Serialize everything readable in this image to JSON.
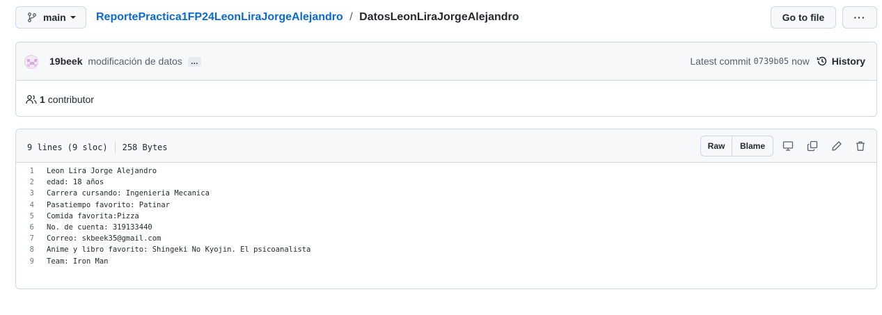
{
  "topbar": {
    "branch": "main",
    "repo": "ReportePractica1FP24LeonLiraJorgeAlejandro",
    "separator": "/",
    "file": "DatosLeonLiraJorgeAlejandro",
    "go_to_file": "Go to file",
    "more": "···"
  },
  "commit": {
    "author": "19beek",
    "message": "modificación de datos",
    "ellipsis": "…",
    "latest_label": "Latest commit",
    "sha": "0739b05",
    "time": "now",
    "history": "History"
  },
  "contributors": {
    "count": "1",
    "label": "contributor"
  },
  "file": {
    "lines_info": "9 lines (9 sloc)",
    "size": "258 Bytes",
    "raw": "Raw",
    "blame": "Blame",
    "lines": [
      {
        "n": "1",
        "text": "Leon Lira Jorge Alejandro"
      },
      {
        "n": "2",
        "text": "edad: 18 años"
      },
      {
        "n": "3",
        "text": "Carrera cursando: Ingenieria Mecanica"
      },
      {
        "n": "4",
        "text": "Pasatiempo favorito: Patinar"
      },
      {
        "n": "5",
        "text": "Comida favorita:Pizza"
      },
      {
        "n": "6",
        "text": "No. de cuenta: 319133440"
      },
      {
        "n": "7",
        "text": "Correo: skbeek35@gmail.com"
      },
      {
        "n": "8",
        "text": "Anime y libro favorito: Shingeki No Kyojin. El psicoanalista"
      },
      {
        "n": "9",
        "text": "Team: Iron Man"
      }
    ]
  },
  "icons": {
    "branch": "git-branch-icon",
    "history": "history-icon",
    "people": "people-icon",
    "display": "desktop-icon",
    "copy": "copy-icon",
    "edit": "pencil-icon",
    "delete": "trash-icon"
  }
}
